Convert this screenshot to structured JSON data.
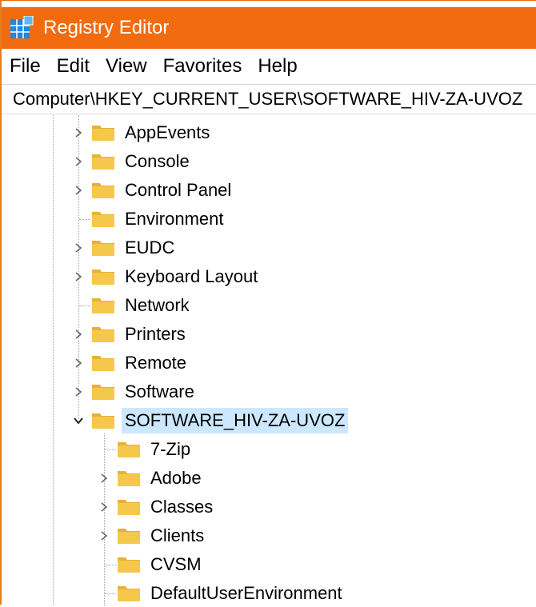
{
  "window": {
    "title": "Registry Editor"
  },
  "menu": [
    "File",
    "Edit",
    "View",
    "Favorites",
    "Help"
  ],
  "address": "Computer\\HKEY_CURRENT_USER\\SOFTWARE_HIV-ZA-UVOZ",
  "colors": {
    "titlebar": "#f26b0f",
    "selection": "#cce8ff",
    "folder": "#f5c84c"
  },
  "tree": {
    "level1": [
      {
        "label": "AppEvents",
        "expander": "collapsed"
      },
      {
        "label": "Console",
        "expander": "collapsed"
      },
      {
        "label": "Control Panel",
        "expander": "collapsed"
      },
      {
        "label": "Environment",
        "expander": "none"
      },
      {
        "label": "EUDC",
        "expander": "collapsed"
      },
      {
        "label": "Keyboard Layout",
        "expander": "collapsed"
      },
      {
        "label": "Network",
        "expander": "none"
      },
      {
        "label": "Printers",
        "expander": "collapsed"
      },
      {
        "label": "Remote",
        "expander": "collapsed"
      },
      {
        "label": "Software",
        "expander": "collapsed"
      },
      {
        "label": "SOFTWARE_HIV-ZA-UVOZ",
        "expander": "expanded",
        "selected": true
      }
    ],
    "level2": [
      {
        "label": "7-Zip",
        "expander": "none"
      },
      {
        "label": "Adobe",
        "expander": "collapsed"
      },
      {
        "label": "Classes",
        "expander": "collapsed"
      },
      {
        "label": "Clients",
        "expander": "collapsed"
      },
      {
        "label": "CVSM",
        "expander": "none"
      },
      {
        "label": "DefaultUserEnvironment",
        "expander": "none"
      }
    ]
  }
}
